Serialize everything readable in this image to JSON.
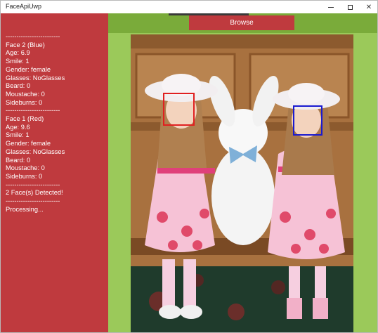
{
  "window": {
    "title": "FaceApiUwp",
    "minimize_glyph": "minimize-icon",
    "maximize_glyph": "maximize-icon",
    "close_glyph": "✕"
  },
  "toolbar": {
    "browse_label": "Browse"
  },
  "log": {
    "lines": [
      "-------------------------",
      "Face 2 (Blue)",
      "Age: 6.9",
      "Smile: 1",
      "Gender: female",
      "Glasses: NoGlasses",
      "Beard: 0",
      "Moustache: 0",
      "Sideburns: 0",
      "-------------------------",
      "Face 1 (Red)",
      "Age: 9.6",
      "Smile: 1",
      "Gender: female",
      "Glasses: NoGlasses",
      "Beard: 0",
      "Moustache: 0",
      "Sideburns: 0",
      "-------------------------",
      "2 Face(s) Detected!",
      "-------------------------",
      "Processing..."
    ]
  },
  "faces": [
    {
      "label": "Face 1 (Red)",
      "color": "#e02020"
    },
    {
      "label": "Face 2 (Blue)",
      "color": "#1a1ad0"
    }
  ],
  "colors": {
    "left_panel": "#bf3a3e",
    "right_panel": "#9bc95a",
    "top_bar": "#7aab3a",
    "button": "#bf3a3e"
  }
}
